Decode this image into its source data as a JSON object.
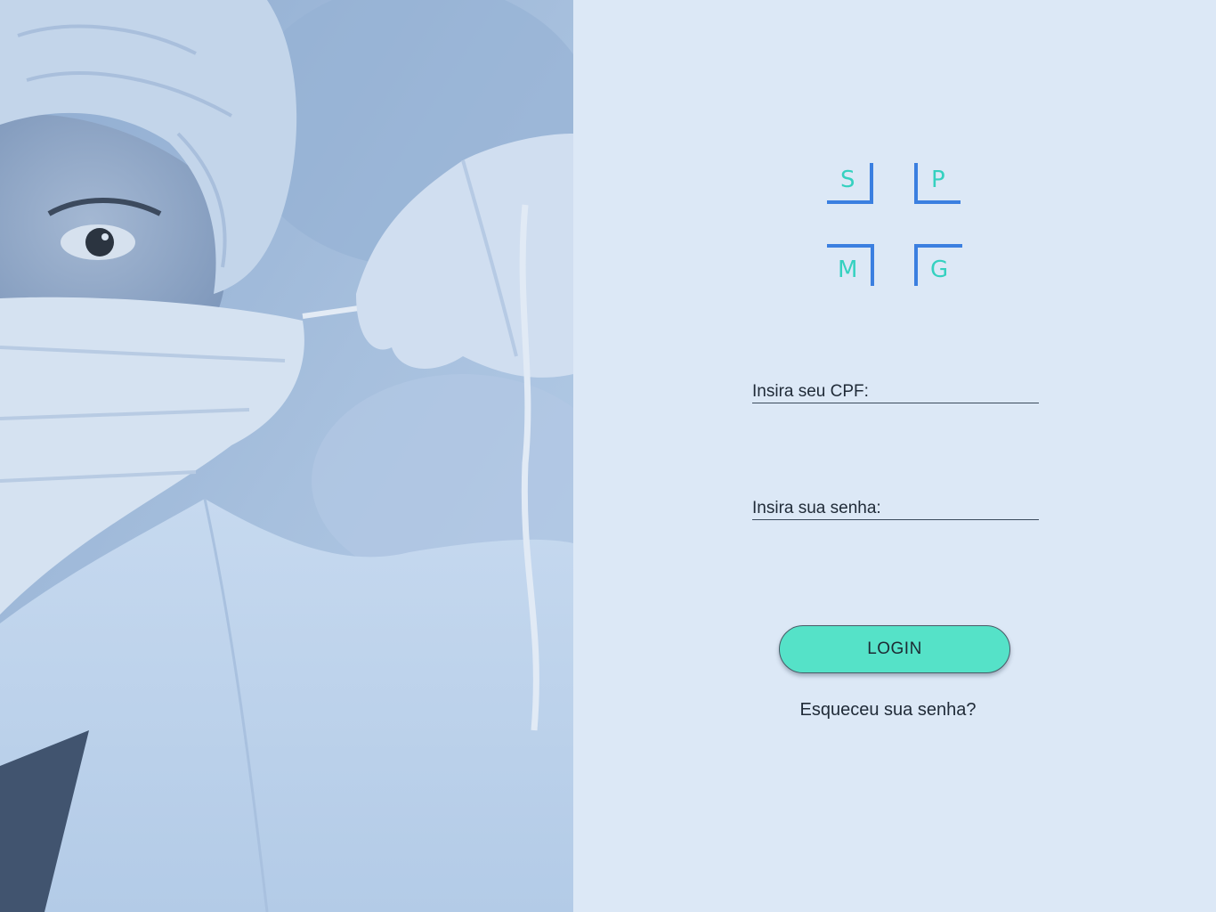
{
  "hero": {
    "image_subject": "healthcare-worker-with-mask-and-cap"
  },
  "logo": {
    "letters": [
      "S",
      "P",
      "M",
      "G"
    ],
    "letter_color": "#35d1c0",
    "frame_color": "#3b7fe0"
  },
  "form": {
    "cpf_label": "Insira seu CPF:",
    "cpf_value": "",
    "password_label": "Insira sua senha:",
    "password_value": "",
    "login_label": "LOGIN",
    "forgot_label": "Esqueceu sua senha?"
  },
  "colors": {
    "panel_bg": "#dce8f6",
    "button_bg": "#55e2c8",
    "text": "#1f2a37"
  }
}
